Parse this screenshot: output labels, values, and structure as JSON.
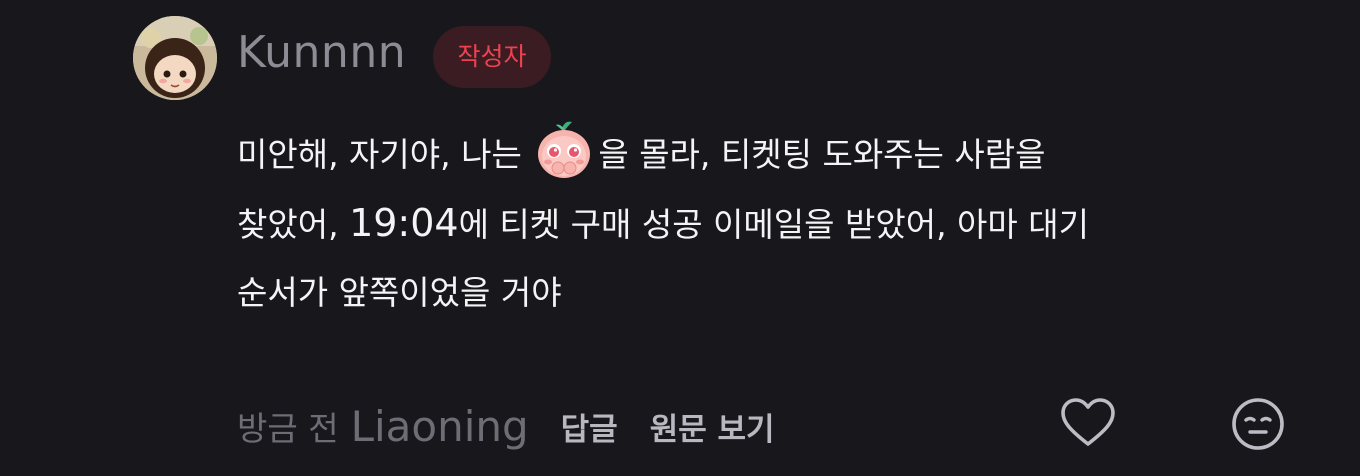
{
  "comment": {
    "author": "Kunnnn",
    "author_badge": "작성자",
    "lines": [
      {
        "before": "미안해, 자기야, 나는 ",
        "emoji": "crying-peach-emoji",
        "after": "을 몰라, 티켓팅 도와주는 사람을"
      },
      {
        "part1": "찾았어, ",
        "time": "19:04",
        "part2": "에 티켓 구매 성공 이메일을 받았어, 아마 대기"
      },
      {
        "text": "순서가 앞쪽이었을 거야"
      }
    ],
    "time_ago": "방금 전",
    "location": "Liaoning",
    "reply_label": "답글",
    "original_label": "원문 보기"
  },
  "icons": {
    "like": "heart-icon",
    "react": "emoji-face-icon"
  },
  "colors": {
    "background": "#18171c",
    "badge_text": "#f0414f",
    "badge_bg": "#3a1c22",
    "body_text": "#f4f4f6",
    "muted": "#6e6c75"
  }
}
